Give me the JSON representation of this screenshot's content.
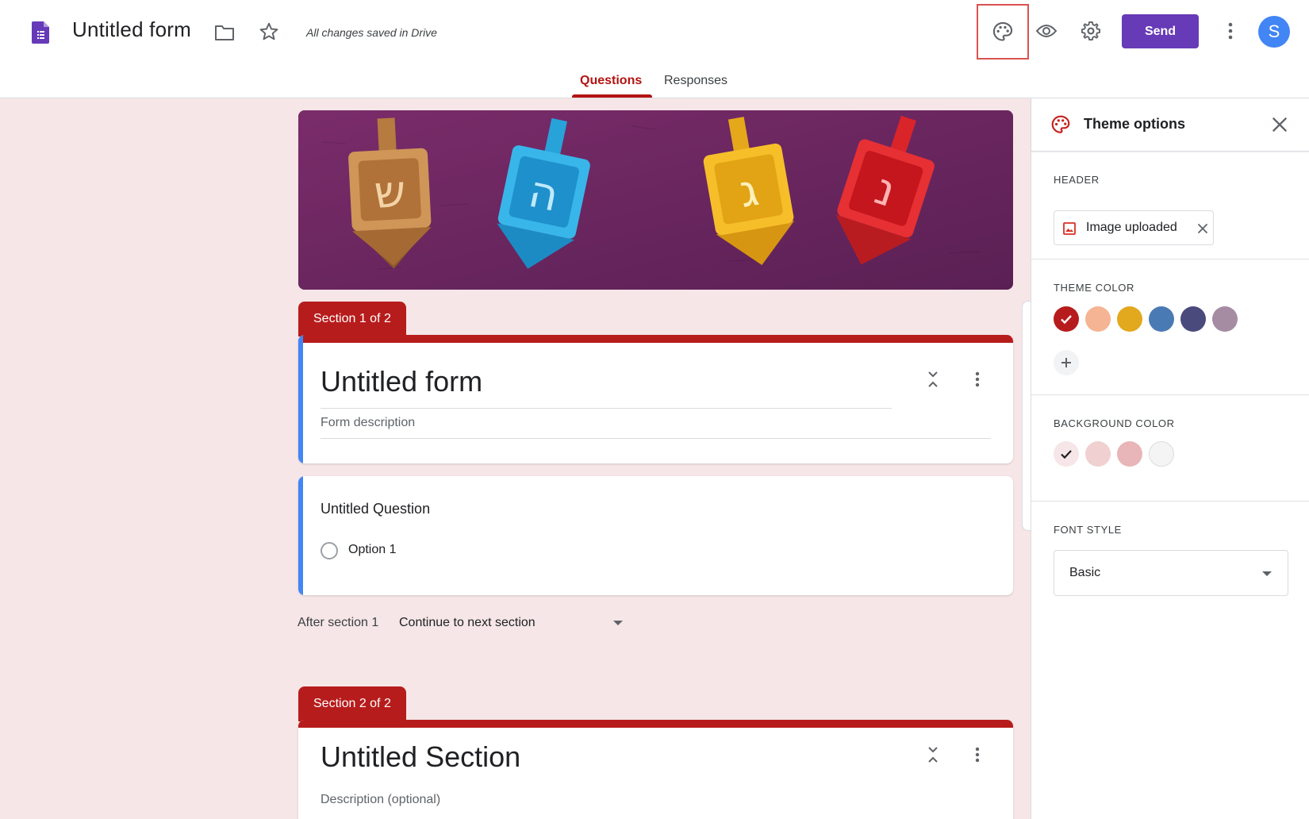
{
  "topbar": {
    "doc_title": "Untitled form",
    "saved_status": "All changes saved in Drive",
    "send_label": "Send",
    "avatar_letter": "S",
    "tabs": [
      {
        "label": "Questions",
        "active": true
      },
      {
        "label": "Responses",
        "active": false
      }
    ],
    "icons": [
      "google-forms-icon",
      "folder-icon",
      "star-icon",
      "palette-icon",
      "eye-icon",
      "gear-icon",
      "more-vert-icon"
    ]
  },
  "form": {
    "section1": {
      "tab_label": "Section 1 of 2",
      "title": "Untitled form",
      "description_placeholder": "Form description"
    },
    "question": {
      "title": "Untitled Question",
      "option": "Option 1"
    },
    "after_section": {
      "label": "After section 1",
      "value": "Continue to next section"
    },
    "section2": {
      "tab_label": "Section 2 of 2",
      "title": "Untitled Section",
      "description_placeholder": "Description (optional)"
    },
    "banner": {
      "letters": [
        "ש",
        "ה",
        "ג",
        "נ"
      ],
      "colors": [
        "#c98a4b",
        "#2ea8e0",
        "#f2b51f",
        "#e0262b"
      ]
    }
  },
  "theme_panel": {
    "title": "Theme options",
    "header": {
      "label": "HEADER",
      "chip_label": "Image uploaded"
    },
    "theme_color": {
      "label": "THEME COLOR",
      "swatches": [
        "#b71c1c",
        "#f5b493",
        "#e2a81e",
        "#4a7ab3",
        "#4a4a7d",
        "#a58ca3"
      ],
      "selected_index": 0
    },
    "background_color": {
      "label": "BACKGROUND COLOR",
      "swatches": [
        "#f6e6e7",
        "#f0d0d1",
        "#e8b6b8",
        "#f4f4f4"
      ],
      "selected_index": 0
    },
    "font_style": {
      "label": "FONT STYLE",
      "value": "Basic"
    }
  },
  "colors": {
    "accent": "#b71c1c",
    "send_button": "#673ab7",
    "canvas_bg": "#f6e6e7",
    "card_left_bar": "#4285f4"
  }
}
